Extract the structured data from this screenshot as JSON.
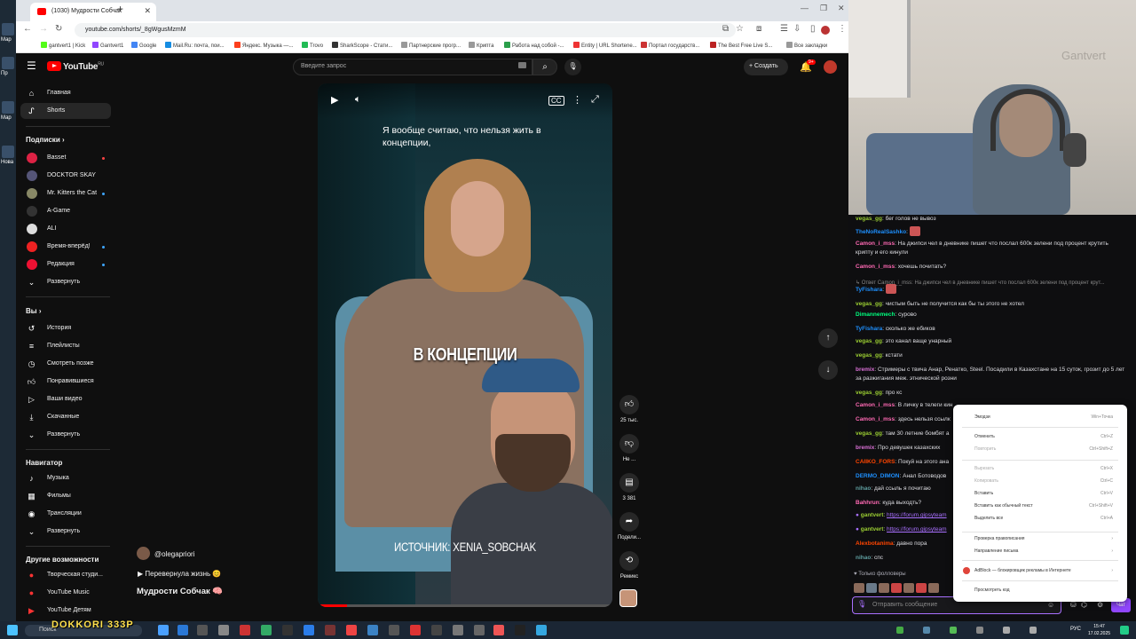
{
  "desktop": {
    "labels": [
      "Мар",
      "Пр",
      "Мар",
      "Нова"
    ]
  },
  "browser": {
    "tab_title": "(1030) Мудрости Собчак",
    "url": "youtube.com/shorts/_8gWgusMzmM",
    "bookmarks": [
      "gantvert1 | Kick",
      "Gantvert1",
      "Google",
      "Mail.Ru: почта, пои...",
      "Яндекс. Музыка —...",
      "Trovo",
      "SharkScope - Стати...",
      "Партнерские прогр...",
      "Криптa",
      "Работа над собой -...",
      "Entity | URL Shortene...",
      "Портал государств...",
      "The Best Free Live S...",
      "Все закладки"
    ]
  },
  "youtube": {
    "logo": "YouTube",
    "logo_region": "RU",
    "search_placeholder": "Введите запрос",
    "create_label": "Создать",
    "notif_count": "9+",
    "sidebar": {
      "main": [
        "Главная",
        "Shorts"
      ],
      "subs_header": "Подписки",
      "subs": [
        "Basset",
        "DOCKTOR SKAY",
        "Mr. Kitters the Cat",
        "A-Game",
        "ALI",
        "Время-вперёд!",
        "Редакция",
        "Развернуть"
      ],
      "you_header": "Вы",
      "you": [
        "История",
        "Плейлисты",
        "Смотреть позже",
        "Понравившиеся",
        "Ваши видео",
        "Скачанные",
        "Развернуть"
      ],
      "nav_header": "Навигатор",
      "nav": [
        "Музыка",
        "Фильмы",
        "Трансляции",
        "Развернуть"
      ],
      "more_header": "Другие возможности",
      "more": [
        "Творческая студи...",
        "YouTube Music",
        "YouTube Детям"
      ]
    },
    "video": {
      "subtitle": "Я вообще считаю, что нельзя жить в концепции,",
      "caption": "В КОНЦЕПЦИИ",
      "source": "ИСТОЧНИК: XENIA_SOBCHAK",
      "progress": 0.1
    },
    "actions": {
      "likes": "25 тыс.",
      "dislike": "Не ...",
      "comments": "3 381",
      "share": "Подели...",
      "remix": "Ремикс"
    },
    "channel": "@olegapriori",
    "related": "Перевернула жизнь 😊",
    "short_title": "Мудрости Собчак 🧠"
  },
  "webcam": {
    "watermark": "Gantvert"
  },
  "chat": {
    "messages": [
      {
        "user": "vegas_gg",
        "color": "#9acd32",
        "text": "бег голов не вывоз"
      },
      {
        "user": "TheNoRealSashko",
        "color": "#1e90ff",
        "text": ""
      },
      {
        "user": "Camon_i_mss",
        "color": "#ff69b4",
        "text": "На джипси чел в дневнике пишет что послал 600к зелени под процент крутить крипту и его кинули"
      },
      {
        "user": "Camon_i_mss",
        "color": "#ff69b4",
        "text": "хочешь почитать?"
      },
      {
        "user": "TyFishara",
        "color": "#1e90ff",
        "text": ""
      },
      {
        "user": "vegas_gg",
        "color": "#9acd32",
        "text": "чистым быть не получится как бы ты этого не хотел"
      },
      {
        "user": "Dimannemech",
        "color": "#00ff7f",
        "text": "сурово"
      },
      {
        "user": "TyFishara",
        "color": "#1e90ff",
        "text": "сколько же ебиков"
      },
      {
        "user": "vegas_gg",
        "color": "#9acd32",
        "text": "это канал ваще унарный"
      },
      {
        "user": "vegas_gg",
        "color": "#9acd32",
        "text": "кстати"
      },
      {
        "user": "bremix",
        "color": "#da70d6",
        "text": "Стримеры с твича Анар, Ренатко, Steel. Посадили в Казахстане на 15 суток, грозит до 5 лет за разжигания меж. этнической розни"
      },
      {
        "user": "vegas_gg",
        "color": "#9acd32",
        "text": "про кс"
      },
      {
        "user": "Camon_i_mss",
        "color": "#ff69b4",
        "text": "В личку в телеги кин"
      },
      {
        "user": "Camon_i_mss",
        "color": "#ff69b4",
        "text": "здесь нельзя ссылк"
      },
      {
        "user": "vegas_gg",
        "color": "#9acd32",
        "text": "там 30 летние бомбят а"
      },
      {
        "user": "bremix",
        "color": "#da70d6",
        "text": "Про девушек казахских"
      },
      {
        "user": "CAIIKO_FORS",
        "color": "#ff4500",
        "text": "Покуй на этого ана"
      },
      {
        "user": "DERMO_DIMON",
        "color": "#1e90ff",
        "text": "Анал Ботоводов"
      },
      {
        "user": "nihao",
        "color": "#5f9ea0",
        "text": "дай ссыль я почитаю"
      },
      {
        "user": "Bahhrun",
        "color": "#ff69b4",
        "text": "куда выходть?"
      },
      {
        "user": "gantvert",
        "color": "#9acd32",
        "text": "",
        "link": "https://forum.gipsyteam"
      },
      {
        "user": "gantvert",
        "color": "#9acd32",
        "text": "",
        "link": "https://forum.gipsyteam"
      },
      {
        "user": "Alexbotanima",
        "color": "#ff4500",
        "text": "давно пора"
      },
      {
        "user": "nihao",
        "color": "#5f9ea0",
        "text": "спс"
      }
    ],
    "reply_note": "↳ Ответ Camon_i_mss: На джипси чел в дневнике пишет что послал 600к зелени под процент крут...",
    "followers_only": "Только фолловеры",
    "input_placeholder": "Отправить сообщение",
    "chat_button": "Чат"
  },
  "context_menu": {
    "items": [
      {
        "label": "Эмодзи",
        "key": "Win+Точка",
        "disabled": false
      },
      {
        "label": "Отменить",
        "key": "Ctrl+Z",
        "disabled": false
      },
      {
        "label": "Повторить",
        "key": "Ctrl+Shift+Z",
        "disabled": true
      },
      {
        "label": "Вырезать",
        "key": "Ctrl+X",
        "disabled": true
      },
      {
        "label": "Копировать",
        "key": "Ctrl+C",
        "disabled": true
      },
      {
        "label": "Вставить",
        "key": "Ctrl+V",
        "disabled": false
      },
      {
        "label": "Вставить как обычный текст",
        "key": "Ctrl+Shift+V",
        "disabled": false
      },
      {
        "label": "Выделить все",
        "key": "Ctrl+A",
        "disabled": false
      },
      {
        "label": "Проверка правописания",
        "key": "›",
        "disabled": false
      },
      {
        "label": "Направление письма",
        "key": "›",
        "disabled": false
      },
      {
        "label": "AdBlock — блокировщик рекламы в Интернете",
        "key": "›",
        "disabled": false
      },
      {
        "label": "Просмотреть код",
        "key": "",
        "disabled": false
      }
    ]
  },
  "taskbar": {
    "search": "Поиск",
    "overlay": "DOKKORI 333P",
    "lang": "РУС",
    "time": "15:47",
    "date": "17.02.2025"
  }
}
